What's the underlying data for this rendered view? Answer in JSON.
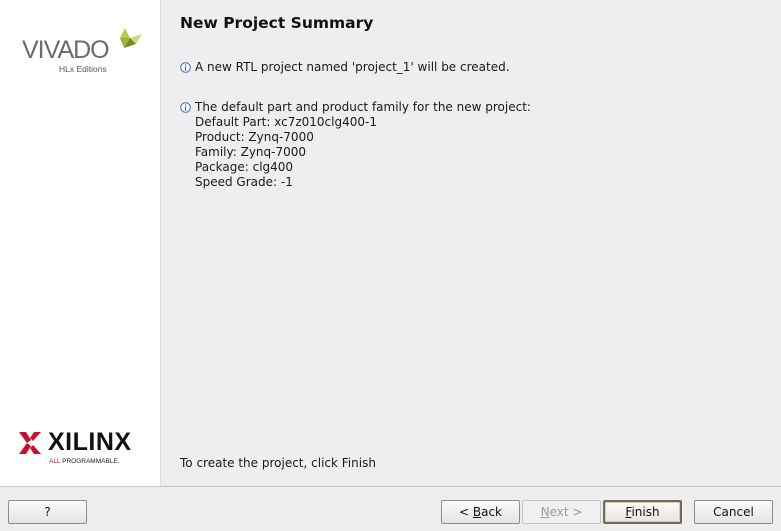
{
  "sidebar": {
    "vivado_logo": {
      "word": "VIVADO",
      "sub": "HLx Editions"
    },
    "xilinx_logo": {
      "word": "XILINX",
      "tag_first": "ALL",
      "tag_rest": " PROGRAMMABLE."
    }
  },
  "main": {
    "title": "New Project Summary",
    "messages": [
      {
        "icon": "info-icon",
        "text": "A new RTL project named 'project_1' will be created."
      },
      {
        "icon": "info-icon",
        "text": "The default part and product family for the new project:"
      }
    ],
    "details": [
      "Default Part: xc7z010clg400-1",
      "Product: Zynq-7000",
      "Family: Zynq-7000",
      "Package: clg400",
      "Speed Grade: -1"
    ],
    "footer_note": "To create the project, click Finish"
  },
  "buttons": {
    "help": "?",
    "back_prefix": "< ",
    "back_mnemonic": "B",
    "back_rest": "ack",
    "next_mnemonic": "N",
    "next_rest": "ext >",
    "finish_mnemonic": "F",
    "finish_rest": "inish",
    "cancel": "Cancel"
  },
  "colors": {
    "vivado_green_light": "#b5cc52",
    "vivado_green_dark": "#6f8a1e",
    "xilinx_red": "#c8102e",
    "info_blue": "#3a6fc4"
  }
}
